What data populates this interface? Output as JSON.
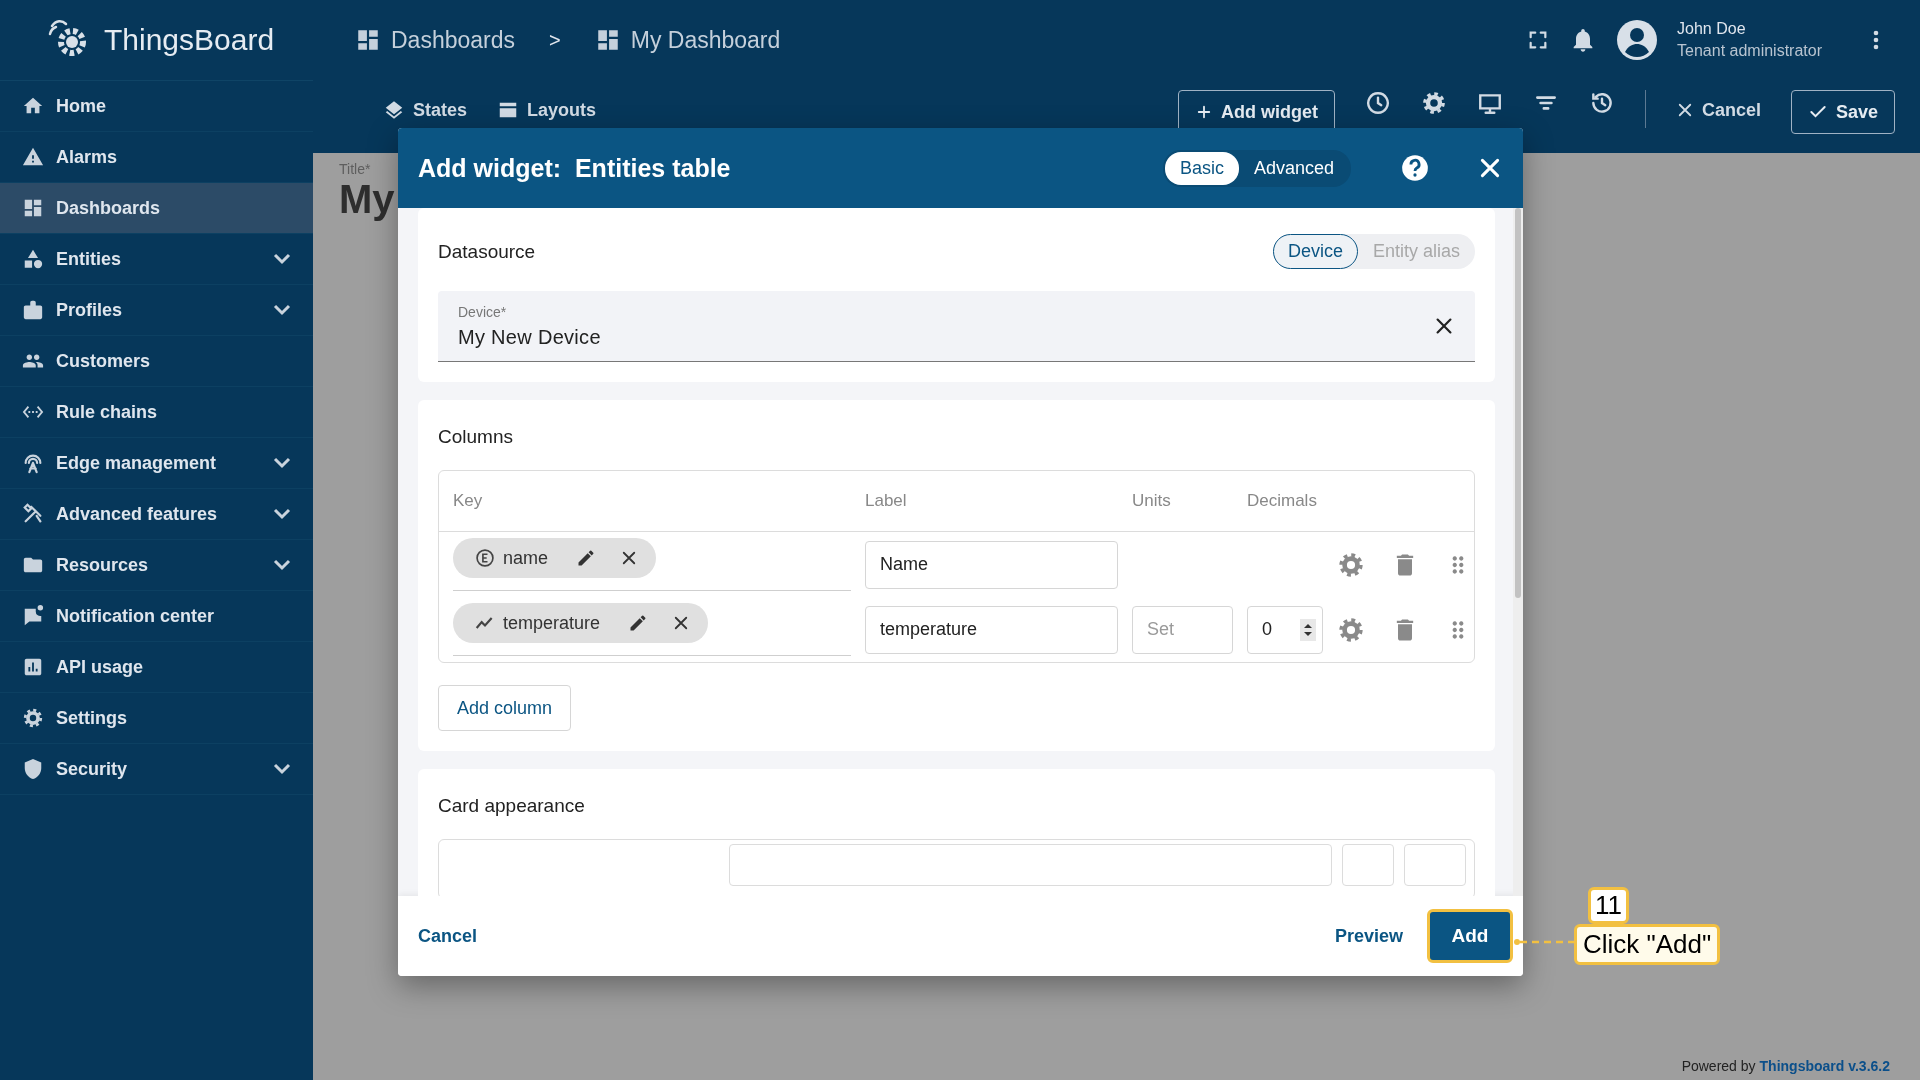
{
  "brand": "ThingsBoard",
  "breadcrumbs": [
    {
      "label": "Dashboards"
    },
    {
      "label": "My Dashboard"
    }
  ],
  "breadcrumb_separator": ">",
  "user": {
    "name": "John Doe",
    "role": "Tenant administrator"
  },
  "sidebar": {
    "items": [
      {
        "label": "Home",
        "selected": false,
        "expandable": false
      },
      {
        "label": "Alarms",
        "selected": false,
        "expandable": false
      },
      {
        "label": "Dashboards",
        "selected": true,
        "expandable": false
      },
      {
        "label": "Entities",
        "selected": false,
        "expandable": true
      },
      {
        "label": "Profiles",
        "selected": false,
        "expandable": true
      },
      {
        "label": "Customers",
        "selected": false,
        "expandable": false
      },
      {
        "label": "Rule chains",
        "selected": false,
        "expandable": false
      },
      {
        "label": "Edge management",
        "selected": false,
        "expandable": true
      },
      {
        "label": "Advanced features",
        "selected": false,
        "expandable": true
      },
      {
        "label": "Resources",
        "selected": false,
        "expandable": true
      },
      {
        "label": "Notification center",
        "selected": false,
        "expandable": false
      },
      {
        "label": "API usage",
        "selected": false,
        "expandable": false
      },
      {
        "label": "Settings",
        "selected": false,
        "expandable": false
      },
      {
        "label": "Security",
        "selected": false,
        "expandable": true
      }
    ]
  },
  "toolbar": {
    "states": "States",
    "layouts": "Layouts",
    "add_widget": "Add widget",
    "cancel": "Cancel",
    "save": "Save"
  },
  "dashboard": {
    "title_label": "Title*",
    "title": "My"
  },
  "dialog": {
    "title": "Add widget:",
    "widget": "Entities table",
    "modes": [
      {
        "label": "Basic",
        "selected": true
      },
      {
        "label": "Advanced",
        "selected": false
      }
    ],
    "datasource": {
      "heading": "Datasource",
      "types": [
        {
          "label": "Device",
          "selected": true
        },
        {
          "label": "Entity alias",
          "selected": false
        }
      ],
      "field": {
        "label": "Device*",
        "value": "My New Device"
      }
    },
    "columns": {
      "heading": "Columns",
      "headers": [
        "Key",
        "Label",
        "Units",
        "Decimals"
      ],
      "rows": [
        {
          "key": "name",
          "kind": "entity",
          "label": "Name"
        },
        {
          "key": "temperature",
          "kind": "timeseries",
          "label": "temperature",
          "units_placeholder": "Set",
          "decimals": "0"
        }
      ],
      "add_button": "Add column"
    },
    "card_heading": "Card appearance",
    "footer": {
      "cancel": "Cancel",
      "preview": "Preview",
      "add": "Add"
    }
  },
  "callout": {
    "step": "11",
    "text": "Click \"Add\""
  },
  "powered_by": {
    "prefix": "Powered by",
    "link": "Thingsboard v.3.6.2"
  }
}
